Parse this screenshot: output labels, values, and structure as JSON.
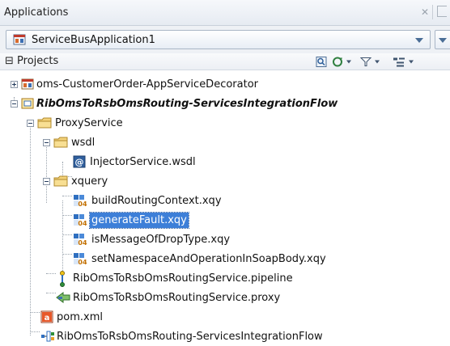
{
  "panel": {
    "title": "Applications"
  },
  "app_selector": {
    "value": "ServiceBusApplication1"
  },
  "projects": {
    "label": "Projects"
  },
  "tree": [
    {
      "label": "oms-CustomerOrder-AppServiceDecorator",
      "icon": "project-icon"
    },
    {
      "label": "RibOmsToRsbOmsRouting-ServicesIntegrationFlow",
      "icon": "project-icon"
    },
    {
      "label": "ProxyService",
      "icon": "folder-icon"
    },
    {
      "label": "wsdl",
      "icon": "folder-icon"
    },
    {
      "label": "InjectorService.wsdl",
      "icon": "wsdl-file-icon"
    },
    {
      "label": "xquery",
      "icon": "folder-icon"
    },
    {
      "label": "buildRoutingContext.xqy",
      "icon": "xquery-file-icon"
    },
    {
      "label": "generateFault.xqy",
      "icon": "xquery-file-icon"
    },
    {
      "label": "isMessageOfDropType.xqy",
      "icon": "xquery-file-icon"
    },
    {
      "label": "setNamespaceAndOperationInSoapBody.xqy",
      "icon": "xquery-file-icon"
    },
    {
      "label": "RibOmsToRsbOmsRoutingService.pipeline",
      "icon": "pipeline-icon"
    },
    {
      "label": "RibOmsToRsbOmsRoutingService.proxy",
      "icon": "proxy-icon"
    },
    {
      "label": "pom.xml",
      "icon": "maven-file-icon"
    },
    {
      "label": "RibOmsToRsbOmsRouting-ServicesIntegrationFlow",
      "icon": "composite-icon"
    }
  ]
}
